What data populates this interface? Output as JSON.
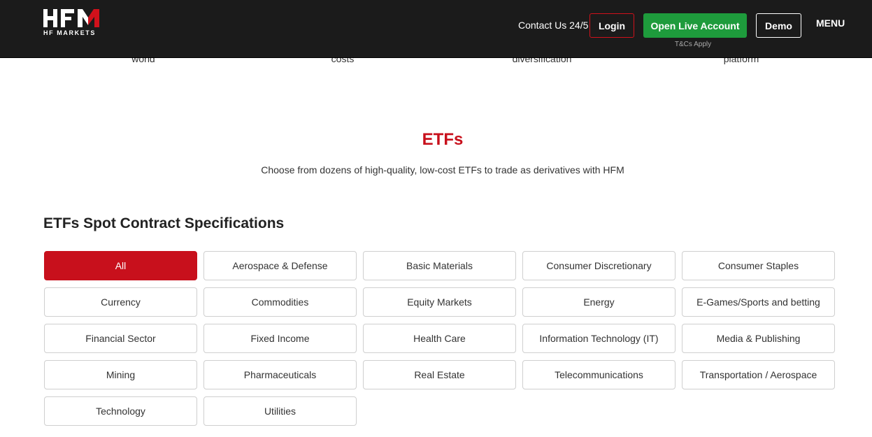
{
  "header": {
    "logo_subtitle": "HF MARKETS",
    "contact": "Contact Us 24/5",
    "login": "Login",
    "open_live": "Open Live Account",
    "tcs": "T&Cs Apply",
    "demo": "Demo",
    "menu": "MENU"
  },
  "peek_words": [
    "world",
    "costs",
    "diversification",
    "platform"
  ],
  "section": {
    "title": "ETFs",
    "subtitle": "Choose from dozens of high-quality, low-cost ETFs to trade as derivatives with HFM",
    "spec_title": "ETFs Spot Contract Specifications"
  },
  "filters": [
    {
      "label": "All",
      "active": true
    },
    {
      "label": "Aerospace & Defense"
    },
    {
      "label": "Basic Materials"
    },
    {
      "label": "Consumer Discretionary"
    },
    {
      "label": "Consumer Staples"
    },
    {
      "label": "Currency"
    },
    {
      "label": "Commodities"
    },
    {
      "label": "Equity Markets"
    },
    {
      "label": "Energy"
    },
    {
      "label": "E-Games/Sports and betting"
    },
    {
      "label": "Financial Sector"
    },
    {
      "label": "Fixed Income"
    },
    {
      "label": "Health Care"
    },
    {
      "label": "Information Technology (IT)"
    },
    {
      "label": "Media & Publishing"
    },
    {
      "label": "Mining"
    },
    {
      "label": "Pharmaceuticals"
    },
    {
      "label": "Real Estate"
    },
    {
      "label": "Telecommunications"
    },
    {
      "label": "Transportation / Aerospace"
    },
    {
      "label": "Technology"
    },
    {
      "label": "Utilities"
    }
  ],
  "colors": {
    "header_bg": "#1b1b1b",
    "accent_red": "#c8101c",
    "cta_green": "#1e9b3c"
  }
}
